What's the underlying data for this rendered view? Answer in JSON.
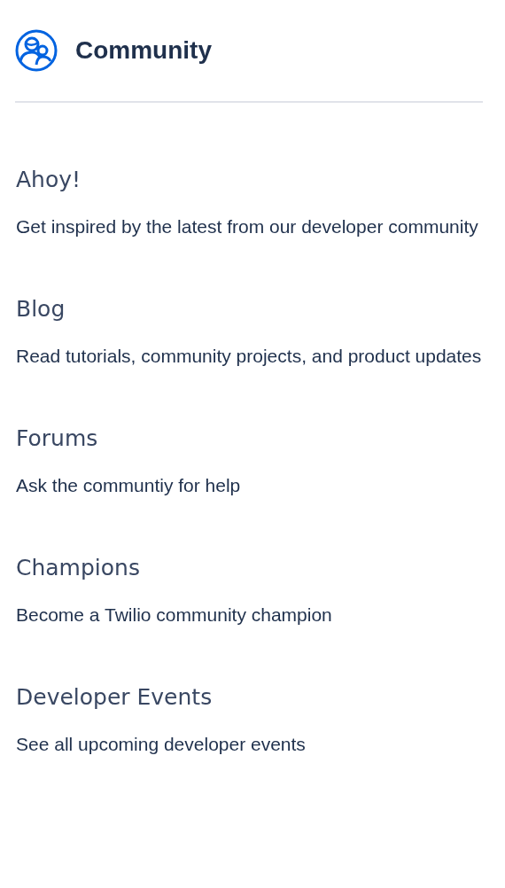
{
  "header": {
    "title": "Community"
  },
  "items": [
    {
      "title": "Ahoy!",
      "description": "Get inspired by the latest from our developer community"
    },
    {
      "title": "Blog",
      "description": "Read tutorials, community projects, and product updates"
    },
    {
      "title": "Forums",
      "description": "Ask the communtiy for help"
    },
    {
      "title": "Champions",
      "description": "Become a Twilio community champion"
    },
    {
      "title": "Developer Events",
      "description": "See all upcoming developer events"
    }
  ]
}
